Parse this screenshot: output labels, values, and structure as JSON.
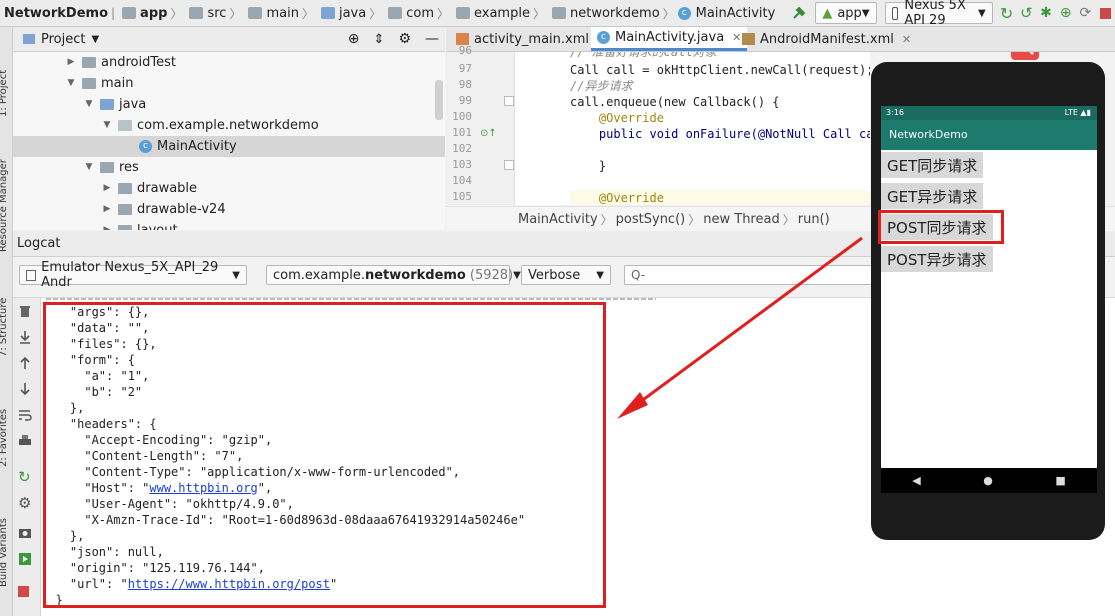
{
  "nav": {
    "crumbs": [
      "NetworkDemo",
      "app",
      "src",
      "main",
      "java",
      "com",
      "example",
      "networkdemo",
      "MainActivity"
    ],
    "run_config": "app",
    "device": "Nexus 5X API 29"
  },
  "project_panel": {
    "title": "Project",
    "tree": [
      {
        "label": "androidTest",
        "indent": 0,
        "arrow": "▶",
        "icon": "folder"
      },
      {
        "label": "main",
        "indent": 0,
        "arrow": "▼",
        "icon": "folder"
      },
      {
        "label": "java",
        "indent": 1,
        "arrow": "▼",
        "icon": "folder-blue"
      },
      {
        "label": "com.example.networkdemo",
        "indent": 2,
        "arrow": "▼",
        "icon": "package"
      },
      {
        "label": "MainActivity",
        "indent": 3,
        "arrow": "",
        "icon": "class"
      },
      {
        "label": "res",
        "indent": 1,
        "arrow": "▼",
        "icon": "folder"
      },
      {
        "label": "drawable",
        "indent": 2,
        "arrow": "▶",
        "icon": "folder"
      },
      {
        "label": "drawable-v24",
        "indent": 2,
        "arrow": "▶",
        "icon": "folder"
      },
      {
        "label": "layout",
        "indent": 2,
        "arrow": "▶",
        "icon": "folder"
      }
    ]
  },
  "editor": {
    "tabs": [
      {
        "label": "activity_main.xml",
        "active": false
      },
      {
        "label": "MainActivity.java",
        "active": true
      },
      {
        "label": "AndroidManifest.xml",
        "active": false
      }
    ],
    "line_numbers": [
      "96",
      "97",
      "98",
      "99",
      "100",
      "101",
      "102",
      "103",
      "104",
      "105"
    ],
    "code_lines": [
      "// 准备好请求的Call对象",
      "Call call = okHttpClient.newCall(request);",
      "//异步请求",
      "call.enqueue(new Callback() {",
      "    @Override",
      "    public void onFailure(@NotNull Call call",
      "",
      "    }",
      "",
      "    @Override"
    ],
    "breadcrumb": [
      "MainActivity",
      "postSync()",
      "new Thread",
      "run()"
    ]
  },
  "logcat": {
    "title": "Logcat",
    "device_select": "Emulator Nexus_5X_API_29 Andr",
    "process_select_prefix": "com.example.",
    "process_select_bold": "networkdemo",
    "process_select_pid": "(5928)",
    "level_select": "Verbose",
    "search_placeholder": "Q-",
    "lines": [
      "    \"args\": {},",
      "    \"data\": \"\",",
      "    \"files\": {},",
      "    \"form\": {",
      "      \"a\": \"1\",",
      "      \"b\": \"2\"",
      "    },",
      "    \"headers\": {",
      "      \"Accept-Encoding\": \"gzip\",",
      "      \"Content-Length\": \"7\",",
      "      \"Content-Type\": \"application/x-www-form-urlencoded\",",
      "      \"Host\": \"",
      "      \"User-Agent\": \"okhttp/4.9.0\",",
      "      \"X-Amzn-Trace-Id\": \"Root=1-60d8963d-08daaa67641932914a50246e\"",
      "    },",
      "    \"json\": null,",
      "    \"origin\": \"125.119.76.144\",",
      "    \"url\": \"",
      "  }"
    ],
    "host_link": "www.httpbin.org",
    "url_link": "https://www.httpbin.org/post",
    "line_suffix": "\","
  },
  "phone": {
    "status_time": "3:16",
    "status_right": "LTE ▲▮",
    "app_title": "NetworkDemo",
    "buttons": [
      "GET同步请求",
      "GET异步请求",
      "POST同步请求",
      "POST异步请求"
    ],
    "nav_back": "◀",
    "nav_home": "●",
    "nav_recent": "■"
  },
  "left_strip": {
    "labels": [
      "1: Project",
      "Resource Manager",
      "7: Structure",
      "2: Favorites",
      "Build Variants"
    ]
  },
  "colors": {
    "annotation_red": "#e02020",
    "phone_appbar": "#1d7b6e",
    "phone_statusbar": "#1a6b5f"
  }
}
